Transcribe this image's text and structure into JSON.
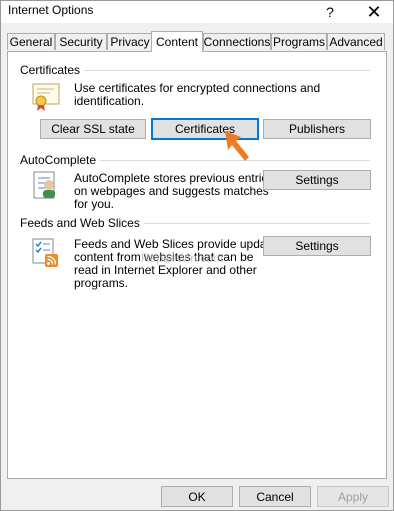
{
  "window": {
    "title": "Internet Options",
    "help_label": "?",
    "close_label": "✕"
  },
  "tabs": [
    {
      "label": "General",
      "active": false
    },
    {
      "label": "Security",
      "active": false
    },
    {
      "label": "Privacy",
      "active": false
    },
    {
      "label": "Content",
      "active": true
    },
    {
      "label": "Connections",
      "active": false
    },
    {
      "label": "Programs",
      "active": false
    },
    {
      "label": "Advanced",
      "active": false
    }
  ],
  "certificates": {
    "heading": "Certificates",
    "description": "Use certificates for encrypted connections and identification.",
    "clear_ssl_label": "Clear SSL state",
    "certificates_label": "Certificates",
    "publishers_label": "Publishers",
    "icon": "certificate-icon"
  },
  "autocomplete": {
    "heading": "AutoComplete",
    "description_lines": [
      "AutoComplete stores previous entries",
      "on webpages and suggests matches",
      "for you."
    ],
    "settings_label": "Settings",
    "icon": "autocomplete-form-icon"
  },
  "feeds": {
    "heading": "Feeds and Web Slices",
    "description_lines": [
      "Feeds and Web Slices provide updated",
      "content from websites that can be",
      "read in Internet Explorer and other",
      "programs."
    ],
    "settings_label": "Settings",
    "icon": "feed-icon"
  },
  "watermark": "RepairWin.com",
  "footer": {
    "ok_label": "OK",
    "cancel_label": "Cancel",
    "apply_label": "Apply"
  },
  "colors": {
    "focus": "#0078d7",
    "arrow": "#f07b22"
  }
}
